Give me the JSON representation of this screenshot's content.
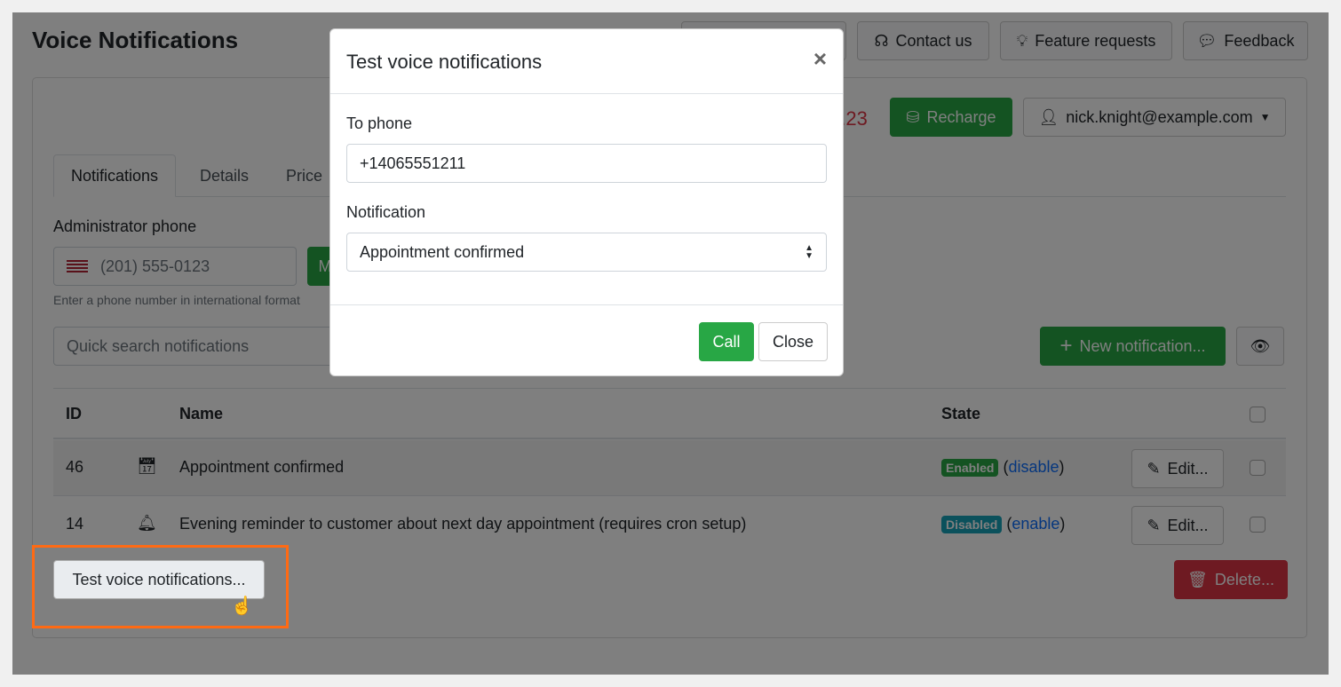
{
  "page": {
    "title": "Voice Notifications"
  },
  "top_buttons": [
    {
      "label": "Contact us",
      "icon": "headset-icon"
    },
    {
      "label": "Feature requests",
      "icon": "lightbulb-icon"
    },
    {
      "label": "Feedback",
      "icon": "chat-icon"
    }
  ],
  "account": {
    "balance_partial": "8.23",
    "recharge_label": "Recharge",
    "user": "nick.knight@example.com"
  },
  "tabs": [
    "Notifications",
    "Details",
    "Price"
  ],
  "admin_phone": {
    "label": "Administrator phone",
    "placeholder": "(201) 555-0123",
    "hint": "Enter a phone number in international format",
    "button_partial": "M"
  },
  "search": {
    "placeholder": "Quick search notifications"
  },
  "new_notification_label": "New notification...",
  "table": {
    "headers": {
      "id": "ID",
      "name": "Name",
      "state": "State"
    },
    "rows": [
      {
        "id": "46",
        "icon": "calendar-check-icon",
        "name": "Appointment confirmed",
        "state": "Enabled",
        "state_color": "#28a745",
        "toggle": "disable",
        "edit": "Edit..."
      },
      {
        "id": "14",
        "icon": "bell-icon",
        "name": "Evening reminder to customer about next day appointment (requires cron setup)",
        "state": "Disabled",
        "state_color": "#17a2b8",
        "toggle": "enable",
        "edit": "Edit..."
      }
    ]
  },
  "test_button_label": "Test voice notifications...",
  "delete_label": "Delete...",
  "modal": {
    "title": "Test voice notifications",
    "to_phone_label": "To phone",
    "to_phone_value": "+14065551211",
    "notification_label": "Notification",
    "notification_value": "Appointment confirmed",
    "call_label": "Call",
    "close_label": "Close"
  },
  "colors": {
    "accent_green": "#28a745",
    "danger": "#dc3545",
    "highlight": "#ff6a13",
    "link": "#0d6efd"
  }
}
